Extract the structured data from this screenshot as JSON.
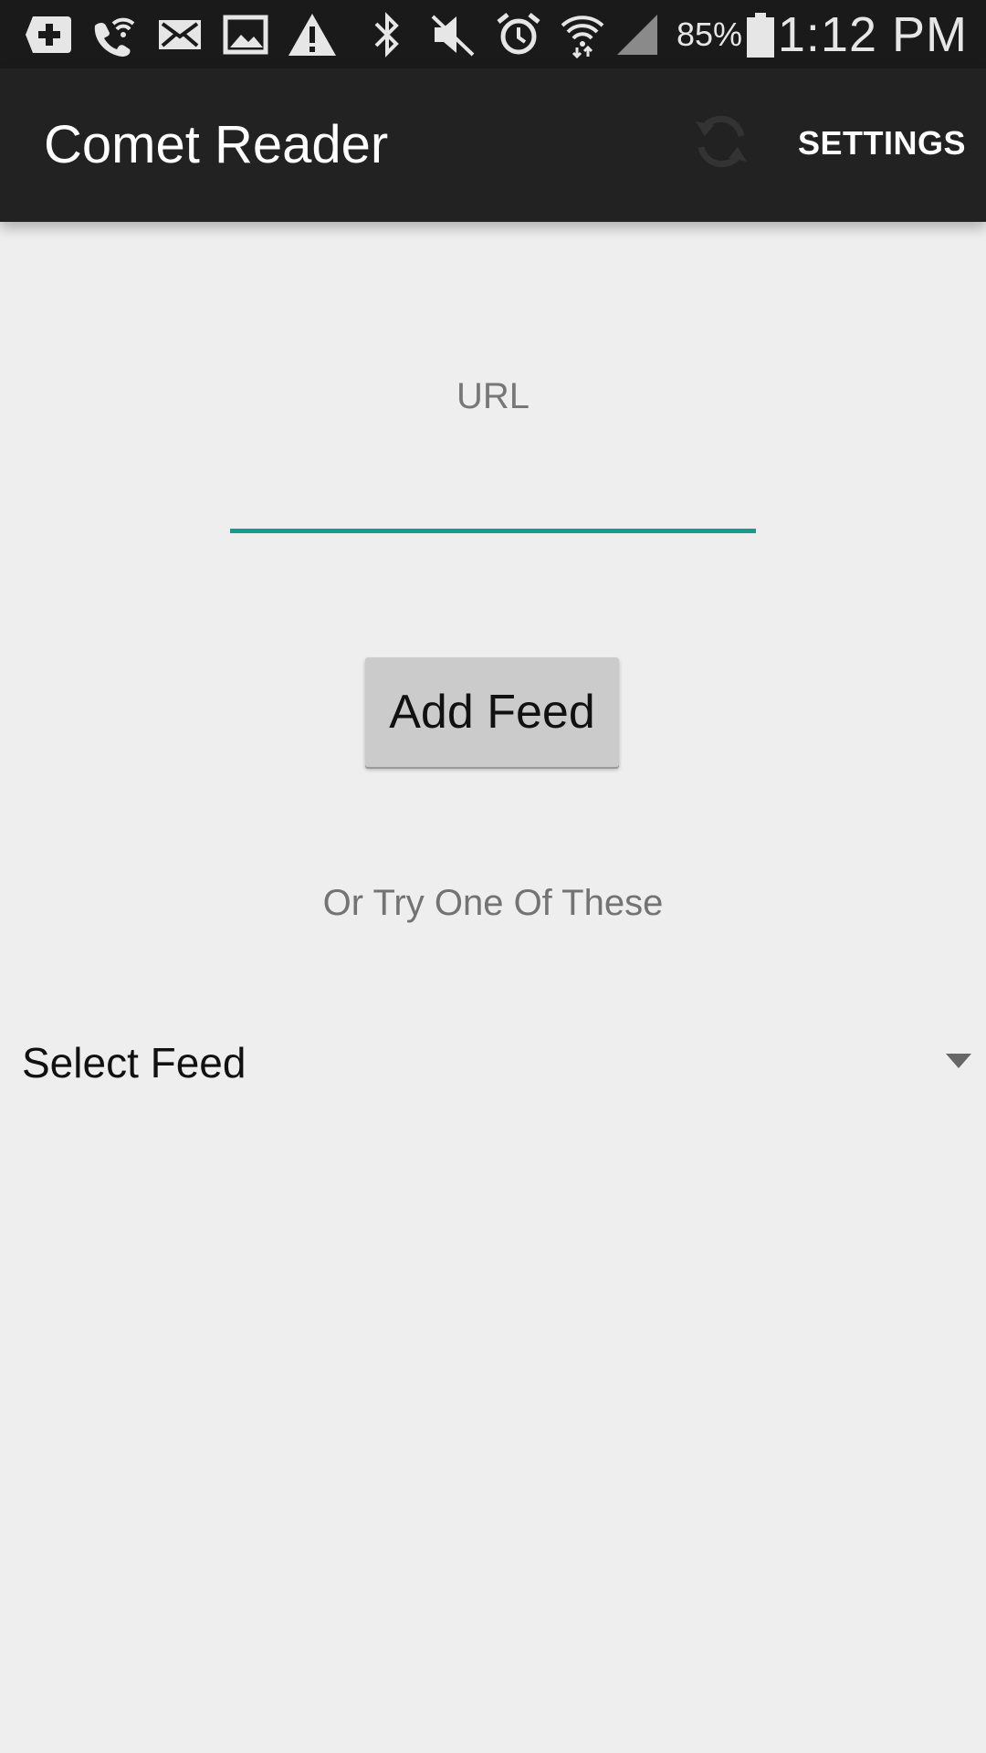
{
  "status_bar": {
    "icons": [
      "add-box-icon",
      "wifi-calling-icon",
      "mail-icon",
      "image-icon",
      "warning-icon",
      "bluetooth-icon",
      "mute-icon",
      "alarm-icon",
      "wifi-icon",
      "signal-icon",
      "battery-icon"
    ],
    "battery_percent": "85%",
    "time": "1:12 PM"
  },
  "app_bar": {
    "title": "Comet Reader",
    "refresh_icon": "refresh-icon",
    "settings_label": "SETTINGS"
  },
  "form": {
    "url_label": "URL",
    "url_value": "",
    "add_feed_label": "Add Feed",
    "try_text": "Or Try One Of These",
    "select_feed_label": "Select Feed"
  },
  "colors": {
    "status_bar_bg": "#1a1a1a",
    "app_bar_bg": "#222222",
    "background": "#eeeeef",
    "accent_teal": "#169c8c",
    "button_bg": "#cbcbcb"
  }
}
